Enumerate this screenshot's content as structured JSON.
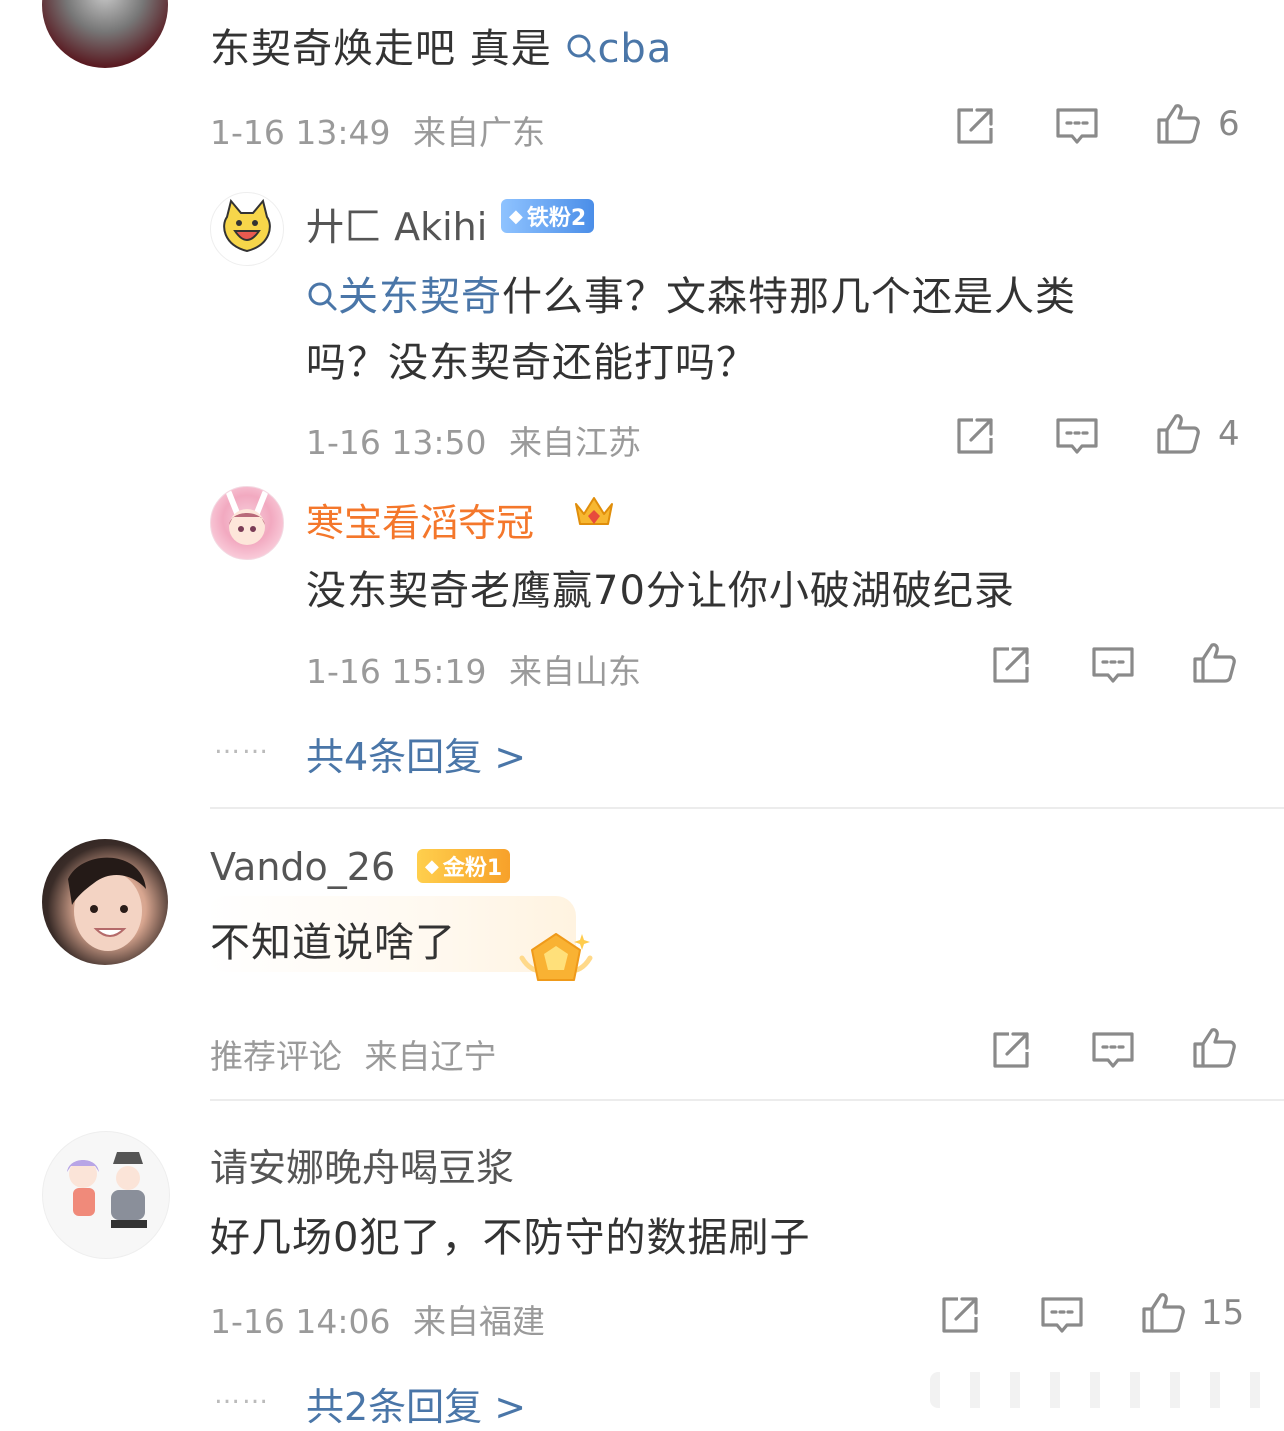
{
  "comments": [
    {
      "text_plain": "东契奇焕走吧 真是",
      "text_link": "cba",
      "time": "1-16 13:49",
      "location": "来自广东",
      "likes": "6",
      "replies": [
        {
          "user": "廾匚 Akihi",
          "badge": "铁粉2",
          "text_link": "关东契奇",
          "text_line1": "什么事？文森特那几个还是人类",
          "text_line2": "吗？没东契奇还能打吗？",
          "time": "1-16 13:50",
          "location": "来自江苏",
          "likes": "4"
        },
        {
          "user": "寒宝看滔夺冠",
          "text": "没东契奇老鹰赢70分让你小破湖破纪录",
          "time": "1-16 15:19",
          "location": "来自山东",
          "likes": ""
        }
      ],
      "more_replies": "共4条回复 >",
      "dots": "……"
    },
    {
      "user": "Vando_26",
      "badge": "金粉1",
      "text": "不知道说啥了",
      "time": "推荐评论",
      "location": "来自辽宁",
      "likes": ""
    },
    {
      "user": "请安娜晚舟喝豆浆",
      "text": "好几场0犯了，不防守的数据刷子",
      "time": "1-16 14:06",
      "location": "来自福建",
      "likes": "15",
      "more_replies": "共2条回复 >",
      "dots": "……"
    }
  ],
  "icons": {
    "share": "share-icon",
    "comment": "comment-icon",
    "like": "thumbs-up-icon",
    "search": "search-icon"
  },
  "colors": {
    "link": "#4a76a8",
    "vip_name": "#f4772b",
    "meta": "#9a9a9a"
  }
}
